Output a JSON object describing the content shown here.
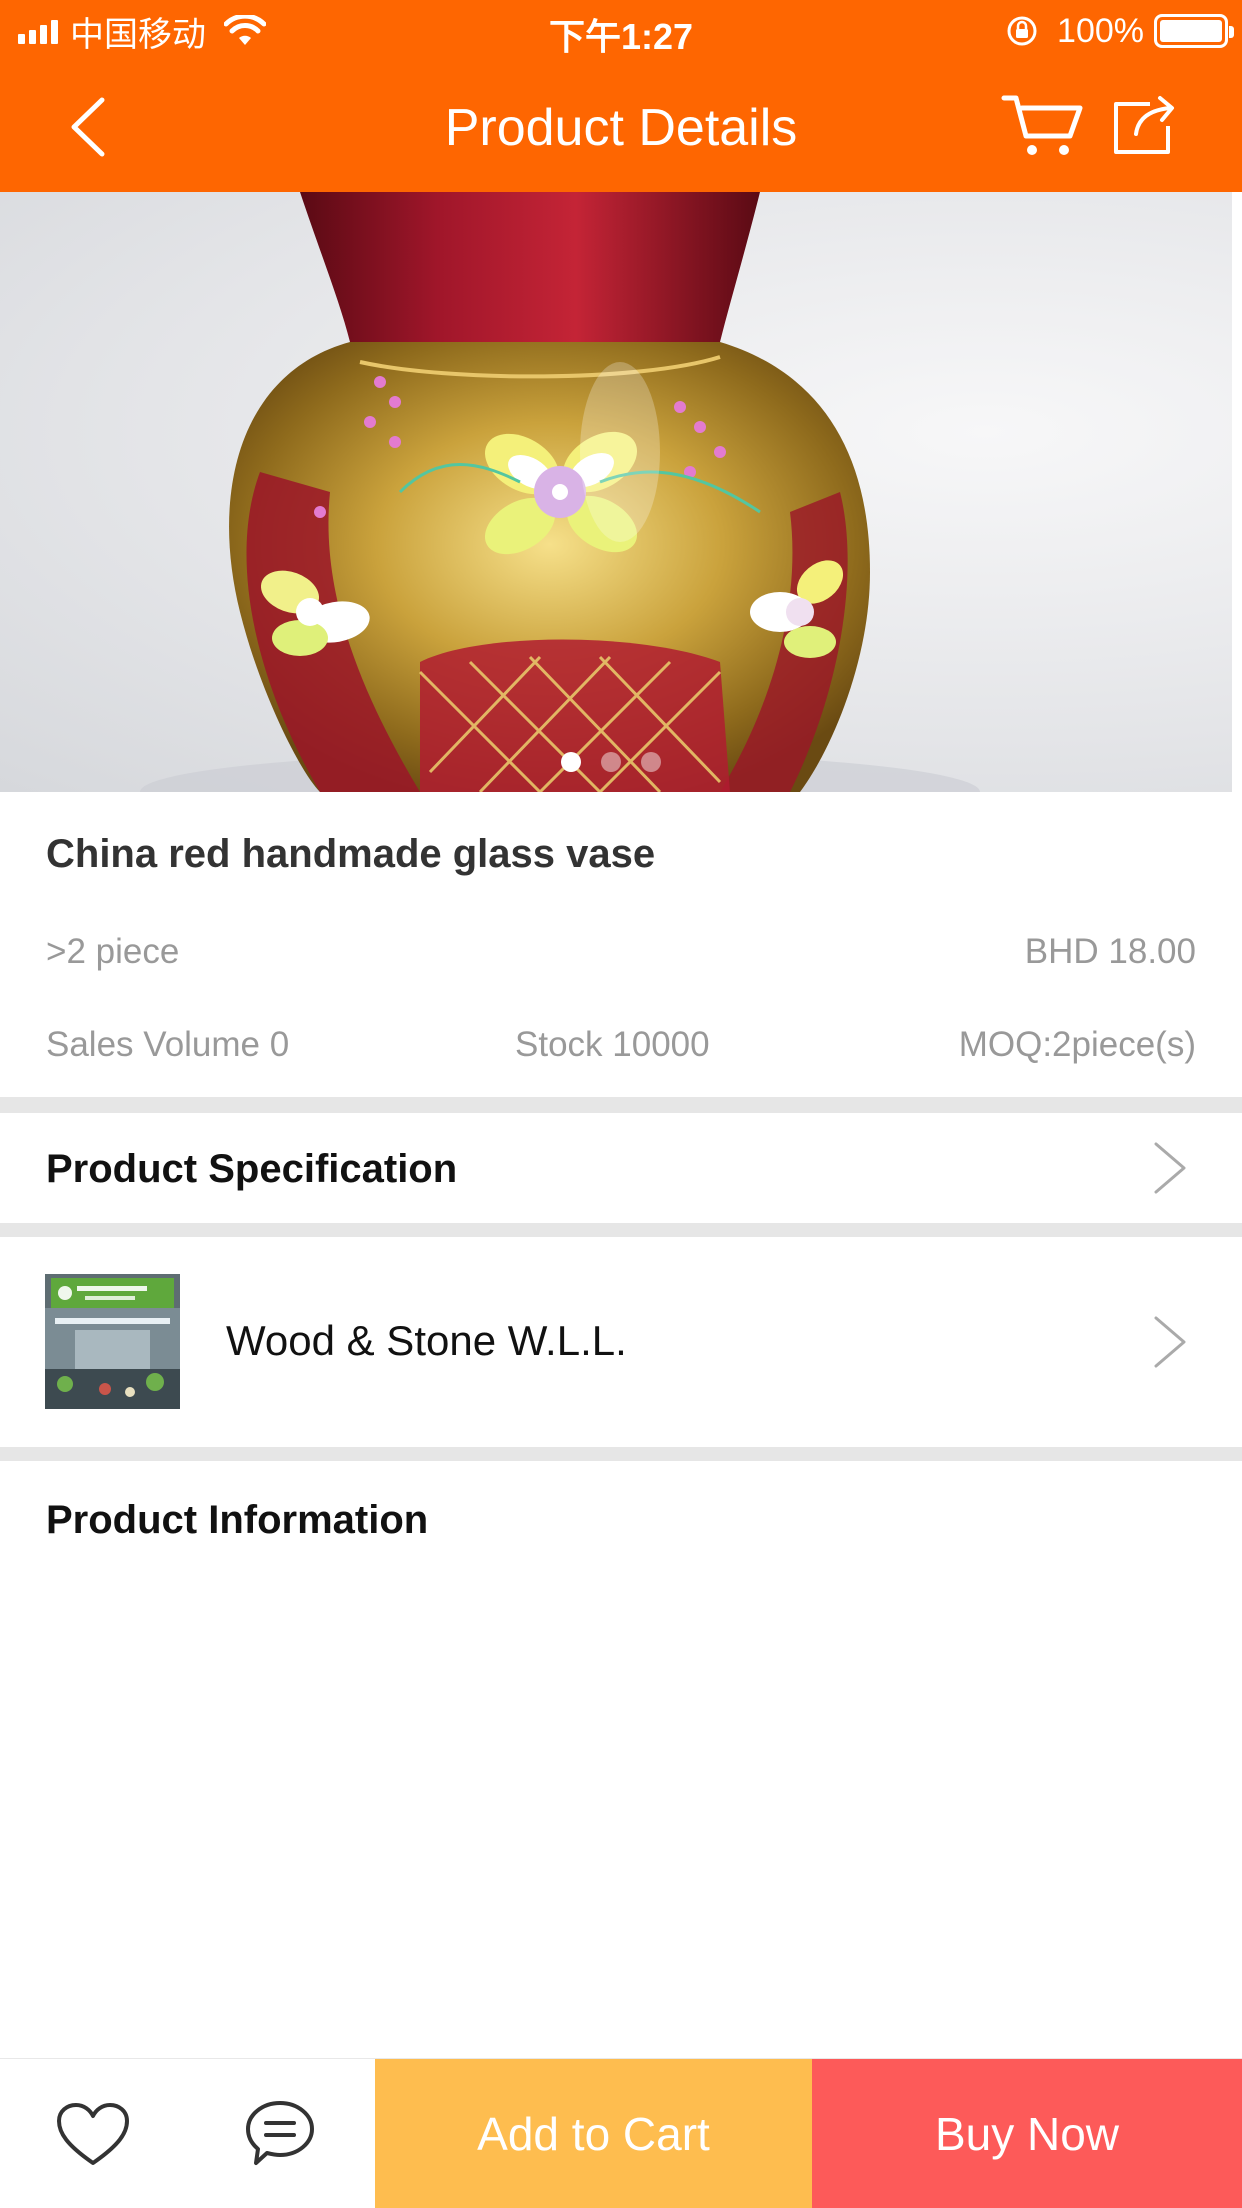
{
  "status_bar": {
    "carrier": "中国移动",
    "time": "下午1:27",
    "battery": "100%"
  },
  "nav": {
    "title": "Product Details",
    "back_icon": "chevron-left-icon",
    "cart_icon": "cart-icon",
    "share_icon": "share-icon"
  },
  "gallery": {
    "description_icon": "product-photo",
    "page_count": 3,
    "active_index": 0
  },
  "product": {
    "title": "China red handmade glass vase",
    "qty_tier": ">2 piece",
    "tier_price": "BHD 18.00",
    "sales_volume": "Sales Volume 0",
    "stock": "Stock 10000",
    "moq": "MOQ:2piece(s)"
  },
  "specification": {
    "label": "Product Specification"
  },
  "store": {
    "name": "Wood & Stone W.L.L."
  },
  "information": {
    "label": "Product Information"
  },
  "bottom_bar": {
    "favorite_icon": "heart-icon",
    "message_icon": "chat-icon",
    "add_to_cart": "Add to Cart",
    "buy_now": "Buy Now"
  },
  "colors": {
    "brand_orange": "#FE6601",
    "cart_button": "#FEBD4F",
    "buy_button": "#FD5A59"
  }
}
